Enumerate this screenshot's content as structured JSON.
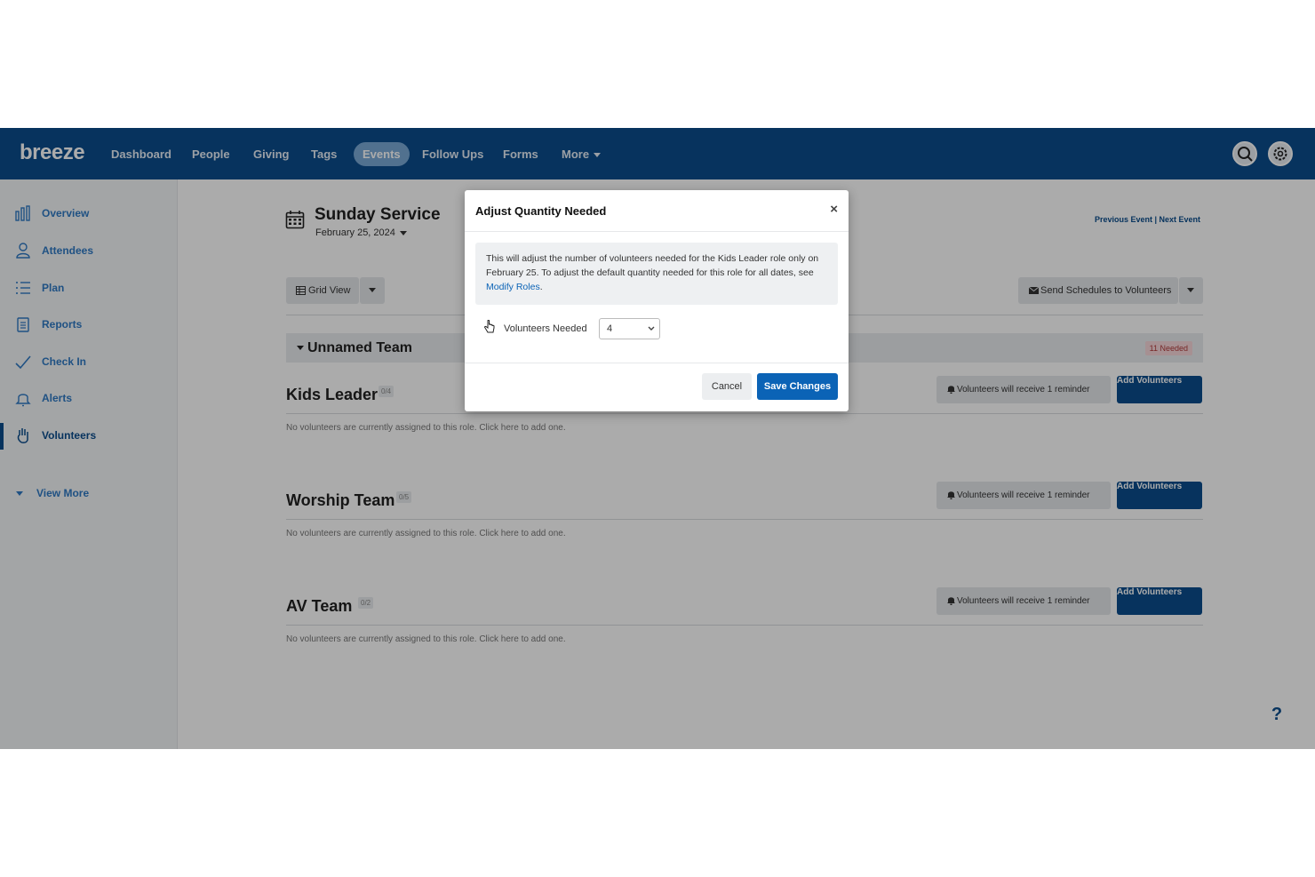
{
  "nav": {
    "logo": "breeze",
    "items": [
      "Dashboard",
      "People",
      "Giving",
      "Tags",
      "Events",
      "Follow Ups",
      "Forms",
      "More"
    ],
    "active": "Events"
  },
  "sidebar": {
    "items": [
      {
        "label": "Overview",
        "icon": "bar-chart-icon"
      },
      {
        "label": "Attendees",
        "icon": "person-icon"
      },
      {
        "label": "Plan",
        "icon": "list-icon"
      },
      {
        "label": "Reports",
        "icon": "clipboard-icon"
      },
      {
        "label": "Check In",
        "icon": "check-icon"
      },
      {
        "label": "Alerts",
        "icon": "bell-icon"
      },
      {
        "label": "Volunteers",
        "icon": "hand-icon"
      }
    ],
    "active": "Volunteers",
    "view_more": "View More"
  },
  "event": {
    "title": "Sunday Service",
    "date": "February 25, 2024",
    "prev_next": "Previous Event | Next Event"
  },
  "toolbar": {
    "grid_view": "Grid View",
    "send_schedules": "Send Schedules to Volunteers"
  },
  "team": {
    "name": "Unnamed Team",
    "needed": "11 Needed"
  },
  "roles": [
    {
      "title": "Kids Leader",
      "badge": "0/4",
      "empty": "No volunteers are currently assigned to this role. Click here to add one.",
      "reminder": "Volunteers will receive 1 reminder",
      "add": "Add Volunteers"
    },
    {
      "title": "Worship Team",
      "badge": "0/5",
      "empty": "No volunteers are currently assigned to this role. Click here to add one.",
      "reminder": "Volunteers will receive 1 reminder",
      "add": "Add Volunteers"
    },
    {
      "title": "AV Team",
      "badge": "0/2",
      "empty": "No volunteers are currently assigned to this role. Click here to add one.",
      "reminder": "Volunteers will receive 1 reminder",
      "add": "Add Volunteers"
    }
  ],
  "help": "?",
  "modal": {
    "title": "Adjust Quantity Needed",
    "close": "×",
    "info_text": "This will adjust the number of volunteers needed for the Kids Leader role only on February 25. To adjust the default quantity needed for this role for all dates, see",
    "info_link": "Modify Roles",
    "info_end": ".",
    "field_label": "Volunteers Needed",
    "field_value": "4",
    "cancel": "Cancel",
    "save": "Save Changes"
  },
  "colors": {
    "nav_bg": "#0b4d8c",
    "primary_button": "#0b63b6"
  }
}
